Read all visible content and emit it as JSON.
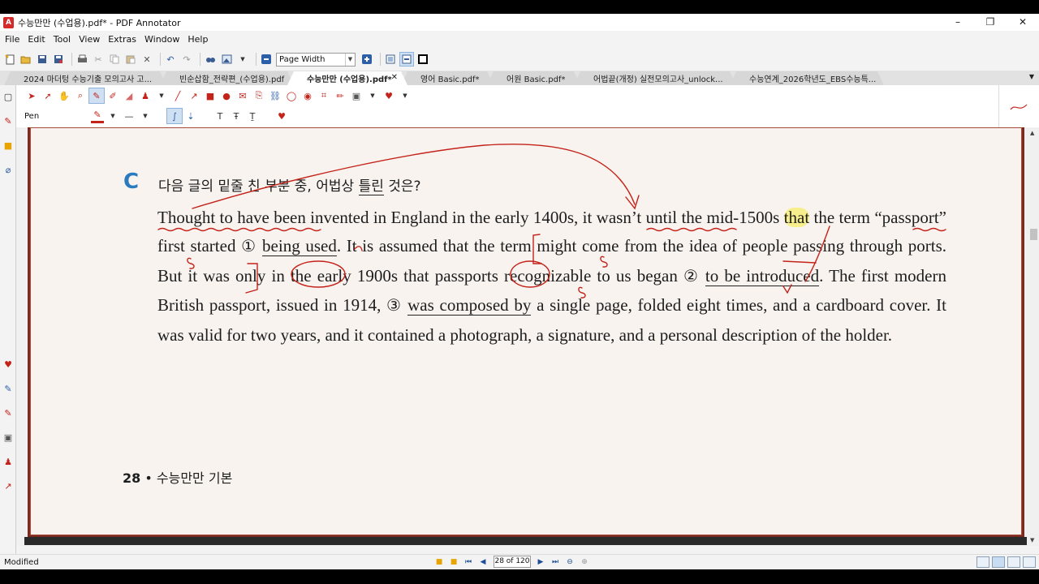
{
  "window": {
    "title": "수능만만 (수업용).pdf* - PDF Annotator",
    "app_icon_letter": "A",
    "controls": {
      "minimize": "–",
      "restore": "❐",
      "close": "✕"
    }
  },
  "menu": [
    "File",
    "Edit",
    "Tool",
    "View",
    "Extras",
    "Window",
    "Help"
  ],
  "toolbar": {
    "zoom_value": "Page Width"
  },
  "tabs": [
    {
      "label": "2024 마더텅 수능기출 모의고사 고..."
    },
    {
      "label": "빈순삽함_전략편_(수업용).pdf"
    },
    {
      "label": "수능만만 (수업용).pdf*",
      "active": true,
      "close": "✕"
    },
    {
      "label": "영어 Basic.pdf*"
    },
    {
      "label": "어원 Basic.pdf*"
    },
    {
      "label": "어법끝(개정) 실전모의고사_unlock..."
    },
    {
      "label": "수능연계_2026학년도_EBS수능특..."
    }
  ],
  "annotation_toolbar": {
    "active_tool_label": "Pen"
  },
  "document": {
    "question_letter": "C",
    "question_prefix": "다음 글의 밑줄 친 부분 중, 어법상 ",
    "question_underlined": "틀린",
    "question_suffix": " 것은?",
    "passage": {
      "s1": "Thought to have been invented in England in the early 1400s, it wasn’t until the mid-1500s ",
      "s1_that": "that",
      "s1_rest": " the term “passport” first started ",
      "n1": "①",
      "u1": "being used",
      "s2": ". It is assumed that the term might come from the idea of people passing through ports. But it was only in the early 1900s that passports recognizable to us began ",
      "n2": "②",
      "u2": "to be introduced",
      "s3": ". The first modern British passport, issued in 1914, ",
      "n3": "③",
      "u3": "was composed by",
      "s4": " a single page, folded eight times, and a cardboard cover. It was valid for two years, and it contained a photograph, a signature, and a personal description of the holder."
    },
    "page_number": "28",
    "page_footer": "• 수능만만 기본"
  },
  "status": {
    "text": "Modified",
    "page_field": "28 of 120"
  },
  "colors": {
    "ink": "#c4231a",
    "highlight": "#f7ef8c",
    "accent": "#2a7ac0",
    "page_border": "#7a2a20"
  }
}
